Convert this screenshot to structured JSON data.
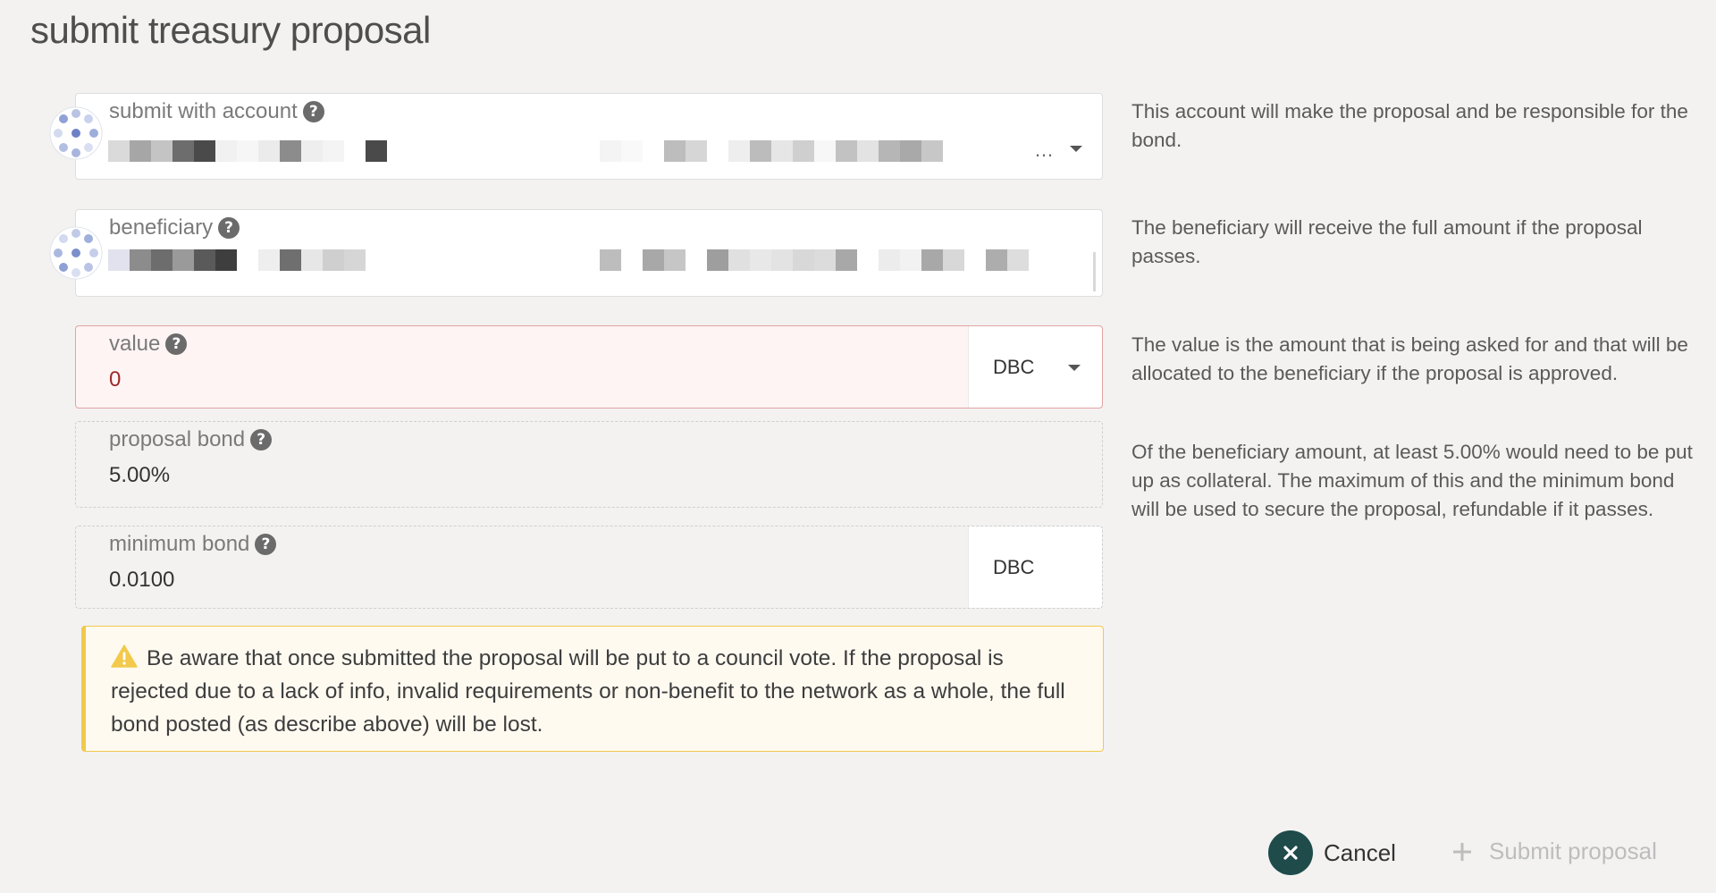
{
  "title": "submit treasury proposal",
  "account": {
    "label": "submit with account",
    "truncation": "…"
  },
  "beneficiary": {
    "label": "beneficiary"
  },
  "value": {
    "label": "value",
    "amount": "0",
    "unit": "DBC"
  },
  "proposal_bond": {
    "label": "proposal bond",
    "amount": "5.00%"
  },
  "minimum_bond": {
    "label": "minimum bond",
    "amount": "0.0100",
    "unit": "DBC"
  },
  "help": {
    "account": "This account will make the proposal and be responsible for the bond.",
    "beneficiary": "The beneficiary will receive the full amount if the proposal passes.",
    "value": "The value is the amount that is being asked for and that will be allocated to the beneficiary if the proposal is approved.",
    "bond": "Of the beneficiary amount, at least 5.00% would need to be put up as collateral. The maximum of this and the minimum bond will be used to secure the proposal, refundable if it passes."
  },
  "warning": {
    "text": "Be aware that once submitted the proposal will be put to a council vote. If the proposal is rejected due to a lack of info, invalid requirements or non-benefit to the network as a whole, the full bond posted (as describe above) will be lost."
  },
  "buttons": {
    "cancel": "Cancel",
    "submit": "Submit proposal"
  },
  "icons": {
    "help": "question-circle-icon",
    "warning": "warning-triangle-icon",
    "cancel": "close-icon",
    "submit": "plus-icon",
    "caret": "chevron-down-icon"
  },
  "colors": {
    "warning_border": "#f2c94c",
    "error_background": "#fff4f4",
    "error_text": "#9b2a2a",
    "cancel_button": "#1f4b4b"
  }
}
